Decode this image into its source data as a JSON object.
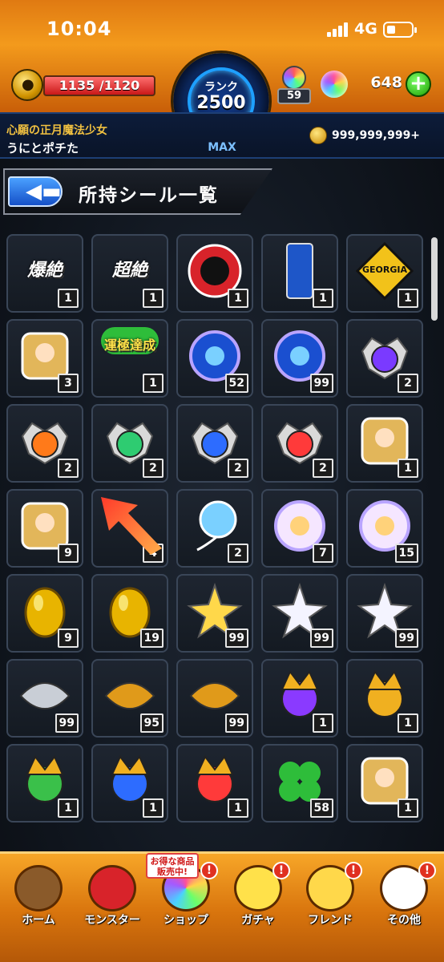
{
  "status_bar": {
    "time": "10:04",
    "network": "4G"
  },
  "header": {
    "stamina": {
      "current": "1135",
      "max": "1120",
      "display": "1135 /1120",
      "fill_percent": 100
    },
    "rank": {
      "label": "ランク",
      "value": "2500",
      "max_label": "MAX"
    },
    "level_badge": "59",
    "orbs": "648",
    "player_title": "心願の正月魔法少女",
    "player_name": "うにとポチた",
    "gold": "999,999,999+"
  },
  "page": {
    "title": "所持シール一覧",
    "back_icon": "back-arrow-icon"
  },
  "colors": {
    "accent_orange": "#f39a1c",
    "rank_blue": "#1ea0ff",
    "header_navy": "#0c1c3a",
    "badge_red": "#e03020"
  },
  "seals": [
    {
      "name": "bakuzetsu",
      "text": "爆絶",
      "count": "1"
    },
    {
      "name": "chouzetsu",
      "text": "超絶",
      "count": "1"
    },
    {
      "name": "red-dragon-emblem",
      "text": "",
      "count": "1"
    },
    {
      "name": "georgia-emerald-mountain-can",
      "text": "",
      "count": "1"
    },
    {
      "name": "georgia-coffee-logo",
      "text": "GEORGIA",
      "count": "1"
    },
    {
      "name": "golden-angel",
      "text": "",
      "count": "3"
    },
    {
      "name": "unkyoku-tassei-clover",
      "text": "運極達成",
      "count": "1"
    },
    {
      "name": "blue-rainbow-flower",
      "text": "",
      "count": "52"
    },
    {
      "name": "blue-gold-flower",
      "text": "",
      "count": "99"
    },
    {
      "name": "purple-orb",
      "text": "",
      "count": "2"
    },
    {
      "name": "fire-orb",
      "text": "",
      "count": "2"
    },
    {
      "name": "green-orb",
      "text": "",
      "count": "2"
    },
    {
      "name": "blue-orb",
      "text": "",
      "count": "2"
    },
    {
      "name": "red-orb",
      "text": "",
      "count": "2"
    },
    {
      "name": "gold-rainbow-hero",
      "text": "",
      "count": "1"
    },
    {
      "name": "golden-hero",
      "text": "",
      "count": "9"
    },
    {
      "name": "empty-slot",
      "text": "",
      "count": "4"
    },
    {
      "name": "rainbow-balloon",
      "text": "",
      "count": "2"
    },
    {
      "name": "rainbow-pearl",
      "text": "",
      "count": "7"
    },
    {
      "name": "rainbow-pearl-large",
      "text": "",
      "count": "15"
    },
    {
      "name": "golden-egg",
      "text": "",
      "count": "9"
    },
    {
      "name": "golden-egg-2",
      "text": "",
      "count": "19"
    },
    {
      "name": "golden-star",
      "text": "",
      "count": "99"
    },
    {
      "name": "white-lotus",
      "text": "",
      "count": "99"
    },
    {
      "name": "pink-lotus",
      "text": "",
      "count": "99"
    },
    {
      "name": "silver-shell",
      "text": "",
      "count": "99"
    },
    {
      "name": "gold-rainbow-shell",
      "text": "",
      "count": "95"
    },
    {
      "name": "gold-shell",
      "text": "",
      "count": "99"
    },
    {
      "name": "purple-jester",
      "text": "",
      "count": "1"
    },
    {
      "name": "gold-jester",
      "text": "",
      "count": "1"
    },
    {
      "name": "green-jester",
      "text": "",
      "count": "1"
    },
    {
      "name": "blue-jester",
      "text": "",
      "count": "1"
    },
    {
      "name": "red-jester",
      "text": "",
      "count": "1"
    },
    {
      "name": "lucky-clover",
      "text": "",
      "count": "58"
    },
    {
      "name": "samurai-card",
      "text": "",
      "count": "1"
    }
  ],
  "nav": [
    {
      "label": "ホーム",
      "icon": "house-icon",
      "badge": ""
    },
    {
      "label": "モンスター",
      "icon": "dragon-icon",
      "badge": ""
    },
    {
      "label": "ショップ",
      "icon": "orb-shop-icon",
      "badge": "!",
      "promo": "お得な商品 販売中!"
    },
    {
      "label": "ガチャ",
      "icon": "egg-icon",
      "badge": "!"
    },
    {
      "label": "フレンド",
      "icon": "friends-icon",
      "badge": "!"
    },
    {
      "label": "その他",
      "icon": "question-icon",
      "badge": "!"
    }
  ]
}
